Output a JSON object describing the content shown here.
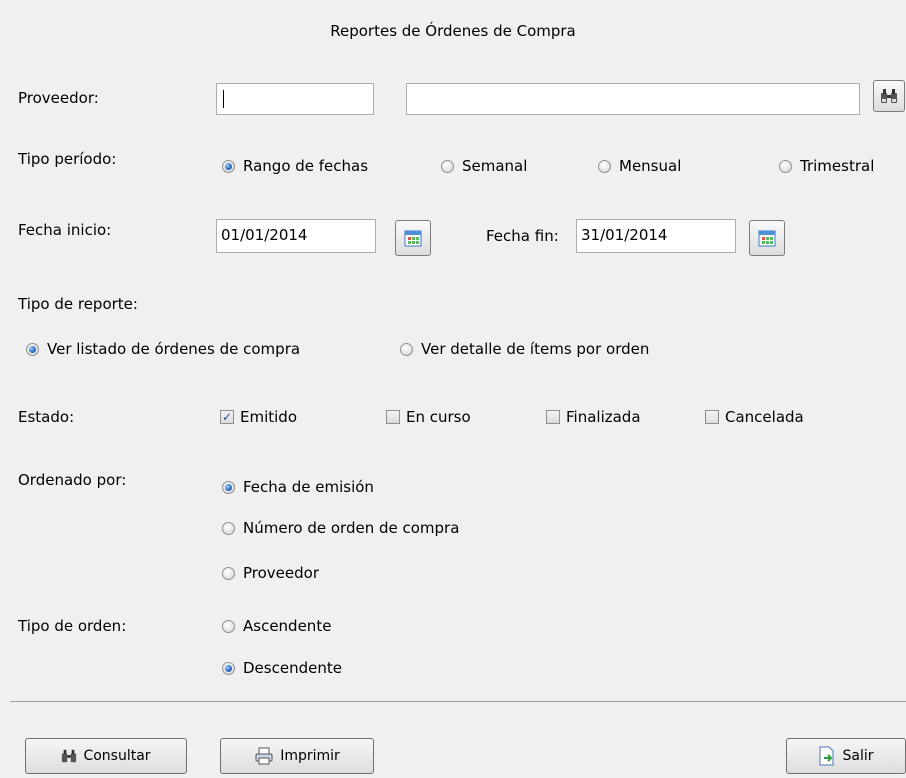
{
  "title": "Reportes de Órdenes de Compra",
  "proveedor": {
    "label": "Proveedor:",
    "code_value": "",
    "name_value": "",
    "search_icon": "binoculars-icon"
  },
  "tipo_periodo": {
    "label": "Tipo período:",
    "options": [
      "Rango de fechas",
      "Semanal",
      "Mensual",
      "Trimestral"
    ],
    "selected": "Rango de fechas"
  },
  "fechas": {
    "inicio_label": "Fecha inicio:",
    "inicio_value": "01/01/2014",
    "fin_label": "Fecha fin:",
    "fin_value": "31/01/2014",
    "calendar_icon": "calendar-icon"
  },
  "tipo_reporte": {
    "label": "Tipo de reporte:",
    "options": [
      "Ver listado de órdenes de compra",
      "Ver detalle de ítems por orden"
    ],
    "selected": "Ver listado de órdenes de compra"
  },
  "estado": {
    "label": "Estado:",
    "options": [
      {
        "label": "Emitido",
        "checked": true
      },
      {
        "label": "En curso",
        "checked": false
      },
      {
        "label": "Finalizada",
        "checked": false
      },
      {
        "label": "Cancelada",
        "checked": false
      }
    ]
  },
  "ordenado_por": {
    "label": "Ordenado por:",
    "options": [
      "Fecha de emisión",
      "Número de orden de compra",
      "Proveedor"
    ],
    "selected": "Fecha de emisión"
  },
  "tipo_orden": {
    "label": "Tipo de orden:",
    "options": [
      "Ascendente",
      "Descendente"
    ],
    "selected": "Descendente"
  },
  "buttons": {
    "consultar": "Consultar",
    "imprimir": "Imprimir",
    "salir": "Salir"
  }
}
